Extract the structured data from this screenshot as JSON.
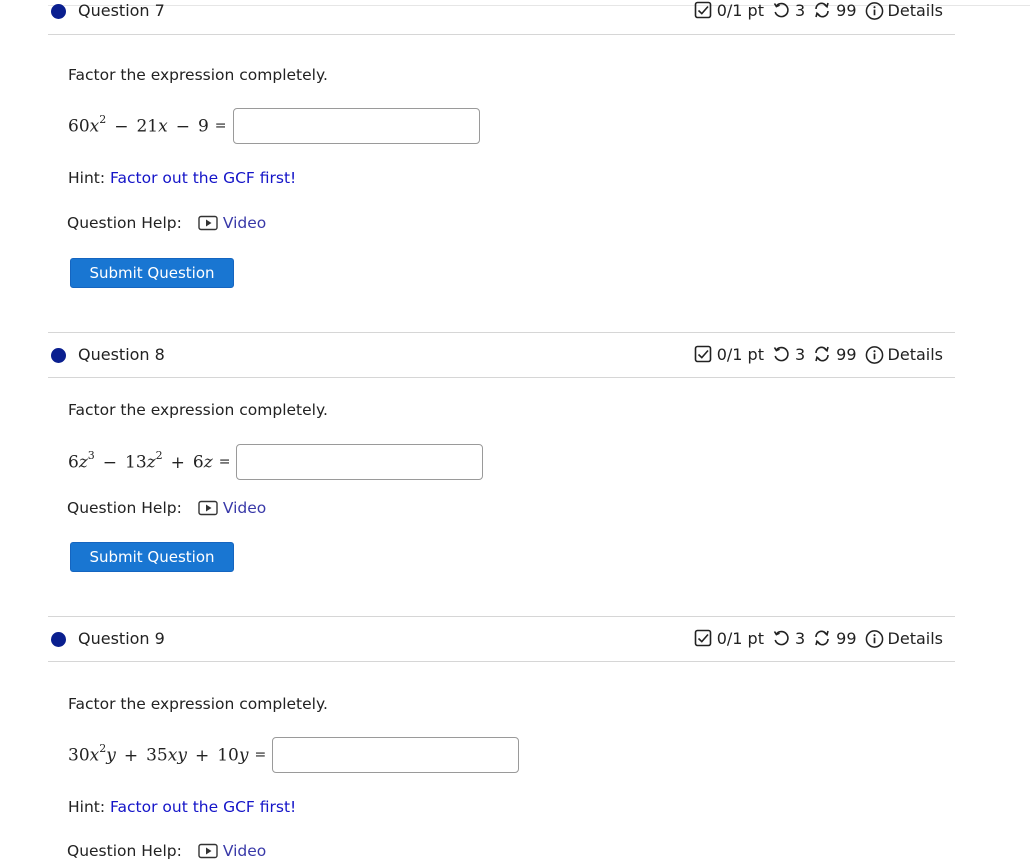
{
  "questions": [
    {
      "title": "Question 7",
      "points": "0/1 pt",
      "retries": "3",
      "attempts": "99",
      "details": "Details",
      "prompt": "Factor the expression completely.",
      "hint_label": "Hint:",
      "hint_link": "Factor out the GCF first!",
      "help_label": "Question Help:",
      "video_label": "Video",
      "submit_label": "Submit Question"
    },
    {
      "title": "Question 8",
      "points": "0/1 pt",
      "retries": "3",
      "attempts": "99",
      "details": "Details",
      "prompt": "Factor the expression completely.",
      "help_label": "Question Help:",
      "video_label": "Video",
      "submit_label": "Submit Question"
    },
    {
      "title": "Question 9",
      "points": "0/1 pt",
      "retries": "3",
      "attempts": "99",
      "details": "Details",
      "prompt": "Factor the expression completely.",
      "hint_label": "Hint:",
      "hint_link": "Factor out the GCF first!",
      "help_label": "Question Help:",
      "video_label": "Video"
    }
  ],
  "expressions": {
    "q7": {
      "t1": "60",
      "v1": "x",
      "e1": "2",
      "op1": "−",
      "t2": "21",
      "v2": "x",
      "op2": "−",
      "t3": "9",
      "eq": "="
    },
    "q8": {
      "t1": "6",
      "v1": "z",
      "e1": "3",
      "op1": "−",
      "t2": "13",
      "v2": "z",
      "e2": "2",
      "op2": "+",
      "t3": "6",
      "v3": "z",
      "eq": "="
    },
    "q9": {
      "t1": "30",
      "v1": "x",
      "e1": "2",
      "v1b": "y",
      "op1": "+",
      "t2": "35",
      "v2": "xy",
      "op2": "+",
      "t3": "10",
      "v3": "y",
      "eq": "="
    }
  },
  "icons": {
    "points": "checkbox-icon",
    "retries": "retry-icon",
    "attempts": "attempts-icon",
    "details": "info-icon",
    "video": "play-icon"
  },
  "colors": {
    "status_dot": "#0a1f8f",
    "submit_button": "#1976d2",
    "hint_link": "#1414c8",
    "video_link": "#3838a8"
  }
}
